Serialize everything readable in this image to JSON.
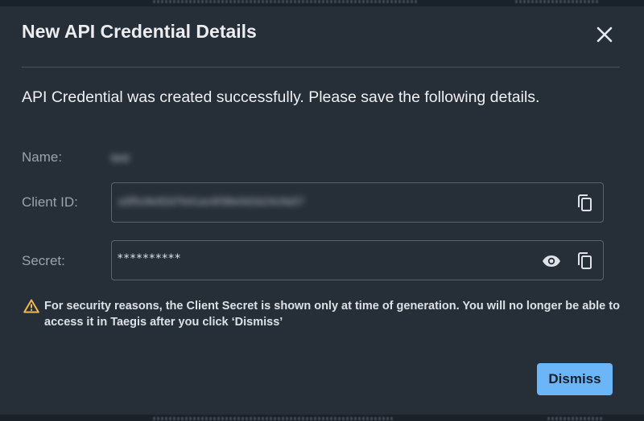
{
  "dialog": {
    "title": "New API Credential Details",
    "close_icon": "close-icon"
  },
  "message": "API Credential was created successfully. Please save the following details.",
  "fields": {
    "name": {
      "label": "Name:",
      "value": "test"
    },
    "client_id": {
      "label": "Client ID:",
      "value": "a3f5c8e92d7b41ac6f38e0d1b24c9a57",
      "copy_icon": "copy-icon"
    },
    "secret": {
      "label": "Secret:",
      "value": "**********",
      "show_icon": "eye-icon",
      "copy_icon": "copy-icon"
    }
  },
  "warning": {
    "icon": "warning-triangle-icon",
    "text": "For security reasons, the Client Secret is shown only at time of generation. You will no longer be able to access it in Taegis after you click ‘Dismiss’"
  },
  "actions": {
    "dismiss_label": "Dismiss"
  },
  "colors": {
    "dialog_background": "#262e38",
    "primary_button": "#6cb5f7",
    "warning": "#f2b84b"
  }
}
